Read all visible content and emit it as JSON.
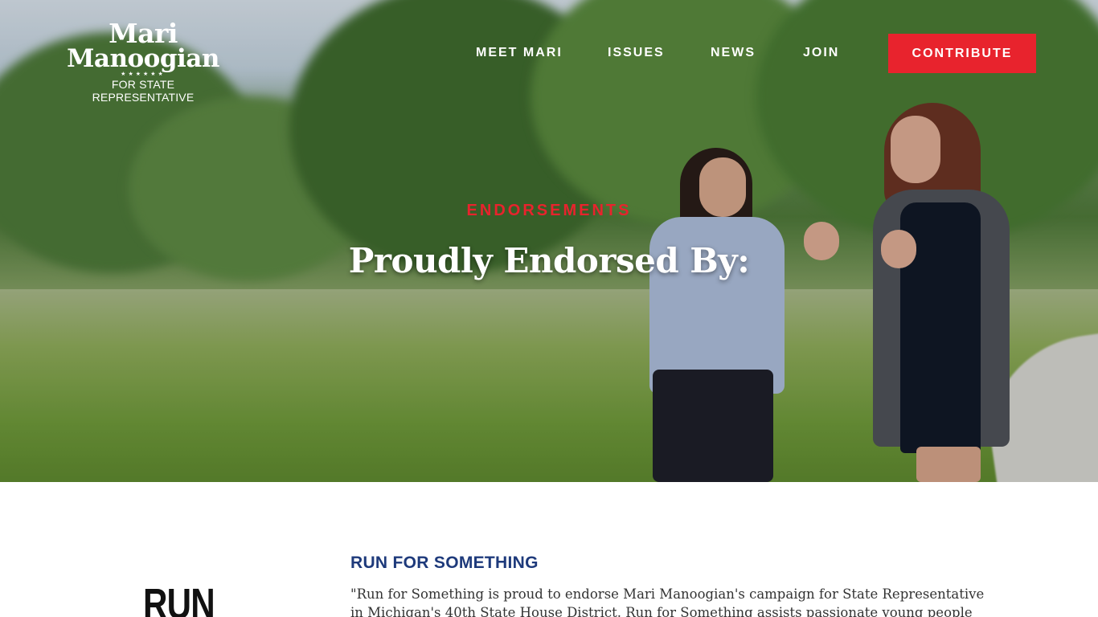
{
  "header": {
    "logo": {
      "line1": "Mari",
      "line2": "Manoogian",
      "stars": "★★★★★★",
      "line3": "FOR STATE REPRESENTATIVE"
    },
    "nav": [
      {
        "label": "MEET MARI"
      },
      {
        "label": "ISSUES"
      },
      {
        "label": "NEWS"
      },
      {
        "label": "JOIN"
      }
    ],
    "contribute_label": "CONTRIBUTE"
  },
  "hero": {
    "eyebrow": "ENDORSEMENTS",
    "headline": "Proudly Endorsed By:"
  },
  "endorsements": [
    {
      "logo_text": "RUN FOR",
      "name": "RUN FOR SOMETHING",
      "quote": "\"Run for Something is proud to endorse Mari Manoogian's campaign for State Representative in Michigan's 40th State House District. Run for Something assists passionate young people"
    }
  ],
  "colors": {
    "accent_red": "#e8232d",
    "navy": "#1e3a7b",
    "white": "#ffffff"
  }
}
